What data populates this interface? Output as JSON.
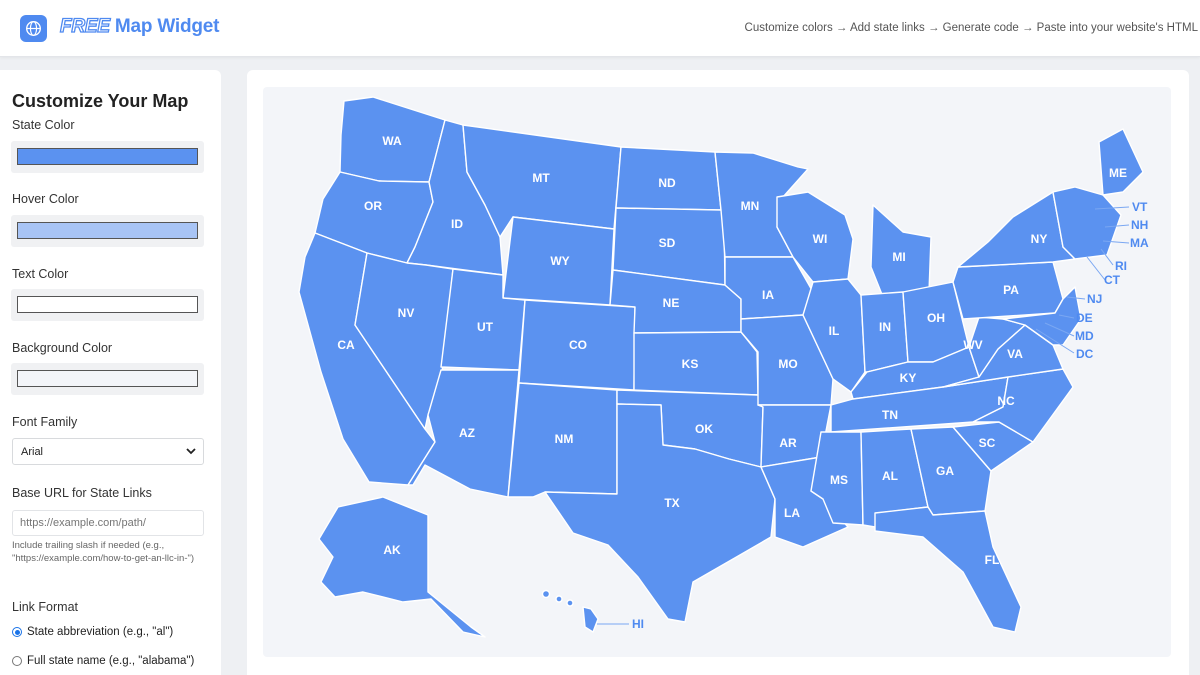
{
  "header": {
    "brand_free": "FREE",
    "brand_rest": "Map Widget",
    "steps": "Customize colors → Add state links → Generate code → Paste into your website's HTML",
    "logo_icon": "globe-icon"
  },
  "sidebar": {
    "title": "Customize Your Map",
    "state_color_label": "State Color",
    "state_color": "#5b92f0",
    "hover_color_label": "Hover Color",
    "hover_color": "#a8c4f5",
    "text_color_label": "Text Color",
    "text_color": "#ffffff",
    "background_color_label": "Background Color",
    "background_color": "#f3f5f9",
    "font_family_label": "Font Family",
    "font_family_value": "Arial",
    "base_url_label": "Base URL for State Links",
    "base_url_placeholder": "https://example.com/path/",
    "base_url_hint": "Include trailing slash if needed (e.g., \"https://example.com/how-to-get-an-llc-in-\")",
    "link_format_label": "Link Format",
    "link_options": [
      {
        "label": "State abbreviation (e.g., \"al\")",
        "selected": true
      },
      {
        "label": "Full state name (e.g., \"alabama\")",
        "selected": false
      }
    ]
  },
  "map": {
    "states": [
      "WA",
      "OR",
      "CA",
      "ID",
      "NV",
      "MT",
      "WY",
      "UT",
      "AZ",
      "CO",
      "NM",
      "ND",
      "SD",
      "NE",
      "KS",
      "OK",
      "TX",
      "MN",
      "IA",
      "MO",
      "AR",
      "LA",
      "WI",
      "IL",
      "MI",
      "IN",
      "OH",
      "KY",
      "TN",
      "MS",
      "AL",
      "GA",
      "FL",
      "SC",
      "NC",
      "VA",
      "WV",
      "PA",
      "NY",
      "ME",
      "AK",
      "HI"
    ],
    "callouts": [
      "VT",
      "NH",
      "MA",
      "RI",
      "CT",
      "NJ",
      "DE",
      "MD",
      "DC"
    ]
  }
}
